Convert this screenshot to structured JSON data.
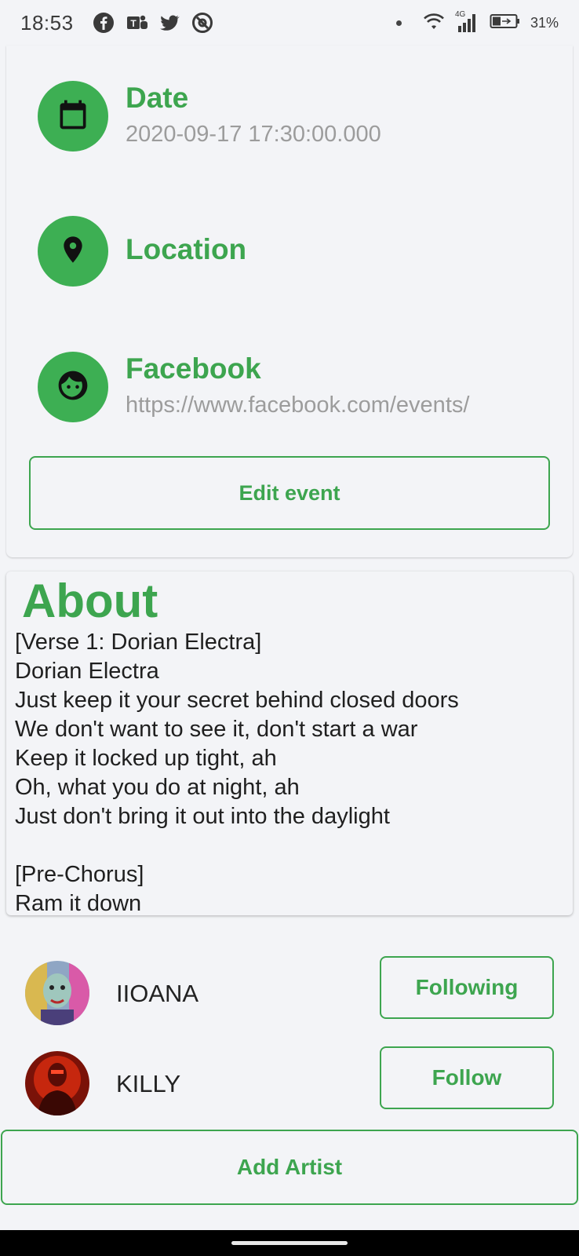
{
  "status_bar": {
    "time": "18:53",
    "network_label": "4G",
    "battery_text": "31%",
    "notification_icons": [
      "facebook-icon",
      "teams-icon",
      "twitter-icon",
      "at-sign-icon"
    ]
  },
  "event": {
    "date": {
      "title": "Date",
      "value": "2020-09-17 17:30:00.000",
      "icon": "calendar-icon"
    },
    "location": {
      "title": "Location",
      "icon": "location-pin-icon"
    },
    "facebook": {
      "title": "Facebook",
      "value": "https://www.facebook.com/events/",
      "icon": "face-icon"
    },
    "edit_label": "Edit event"
  },
  "about": {
    "title": "About",
    "text": "[Verse 1: Dorian Electra]\nDorian Electra\nJust keep it your secret behind closed doors\nWe don't want to see it, don't start a war\nKeep it locked up tight, ah\nOh, what you do at night, ah\nJust don't bring it out into the daylight\n\n[Pre-Chorus]\nRam it down"
  },
  "artists": [
    {
      "name": "IIOANA",
      "button": "Following"
    },
    {
      "name": "KILLY",
      "button": "Follow"
    }
  ],
  "add_artist_label": "Add Artist",
  "colors": {
    "accent": "#3da54f",
    "icon_circle": "#3daf53",
    "background": "#f3f4f7",
    "muted_text": "#9c9c9c"
  }
}
